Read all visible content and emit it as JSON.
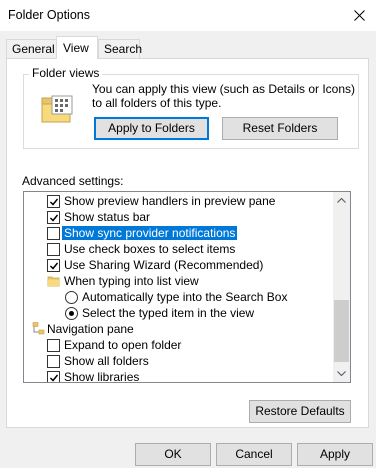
{
  "window": {
    "title": "Folder Options"
  },
  "tabs": [
    {
      "label": "General"
    },
    {
      "label": "View"
    },
    {
      "label": "Search"
    }
  ],
  "folder_views": {
    "group_label": "Folder views",
    "description": "You can apply this view (such as Details or Icons) to all folders of this type.",
    "apply_label": "Apply to Folders",
    "reset_label": "Reset Folders"
  },
  "advanced": {
    "label": "Advanced settings:",
    "items": [
      {
        "type": "checkbox",
        "label": "Show preview handlers in preview pane",
        "checked": true
      },
      {
        "type": "checkbox",
        "label": "Show status bar",
        "checked": true
      },
      {
        "type": "checkbox",
        "label": "Show sync provider notifications",
        "checked": false,
        "selected": true
      },
      {
        "type": "checkbox",
        "label": "Use check boxes to select items",
        "checked": false
      },
      {
        "type": "checkbox",
        "label": "Use Sharing Wizard (Recommended)",
        "checked": true
      },
      {
        "type": "folder",
        "label": "When typing into list view"
      },
      {
        "type": "radio",
        "label": "Automatically type into the Search Box",
        "checked": false
      },
      {
        "type": "radio",
        "label": "Select the typed item in the view",
        "checked": true
      },
      {
        "type": "nav",
        "label": "Navigation pane"
      },
      {
        "type": "checkbox",
        "label": "Expand to open folder",
        "checked": false
      },
      {
        "type": "checkbox",
        "label": "Show all folders",
        "checked": false
      },
      {
        "type": "checkbox",
        "label": "Show libraries",
        "checked": true
      }
    ]
  },
  "restore_label": "Restore Defaults",
  "footer": {
    "ok": "OK",
    "cancel": "Cancel",
    "apply": "Apply"
  },
  "colors": {
    "selection": "#0078d7",
    "accent_border": "#0078d7"
  },
  "icons": {
    "close": "close-icon",
    "folder": "folder-views-icon",
    "scroll_up": "chevron-up-icon",
    "scroll_down": "chevron-down-icon"
  }
}
